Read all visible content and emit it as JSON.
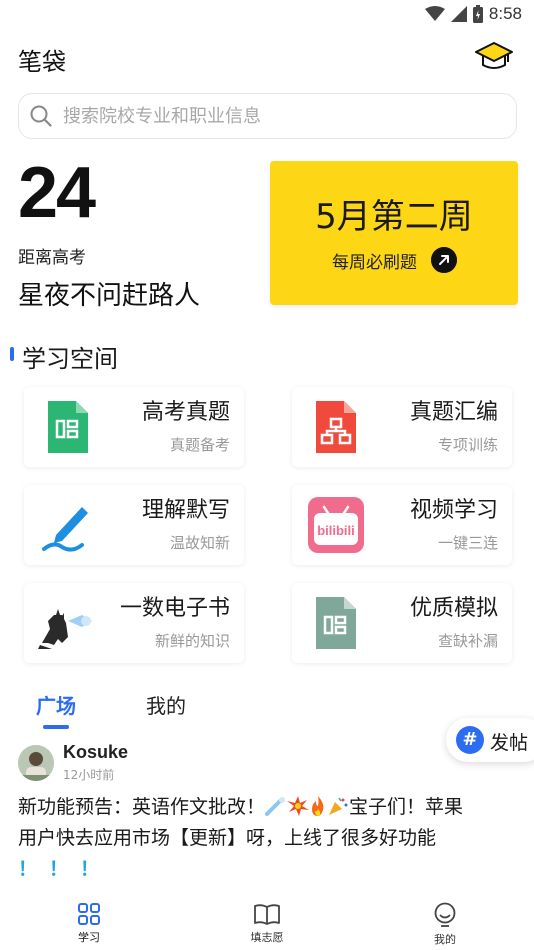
{
  "status_bar": {
    "time": "8:58"
  },
  "header": {
    "title": "笔袋",
    "icon": "graduation-cap-icon"
  },
  "search": {
    "placeholder": "搜索院校专业和职业信息",
    "icon": "search-icon"
  },
  "countdown": {
    "days": "24",
    "label": "距离高考",
    "motto": "星夜不问赶路人"
  },
  "week_card": {
    "title": "5月第二周",
    "subtitle": "每周必刷题",
    "color": "#fdd715"
  },
  "study_space": {
    "title": "学习空间",
    "tiles": [
      {
        "name": "高考真题",
        "sub": "真题备考",
        "icon": "green-document-icon"
      },
      {
        "name": "真题汇编",
        "sub": "专项训练",
        "icon": "red-document-icon"
      },
      {
        "name": "理解默写",
        "sub": "温故知新",
        "icon": "pen-icon"
      },
      {
        "name": "视频学习",
        "sub": "一键三连",
        "icon": "bilibili-icon"
      },
      {
        "name": "一数电子书",
        "sub": "新鲜的知识",
        "icon": "godzilla-icon"
      },
      {
        "name": "优质模拟",
        "sub": "查缺补漏",
        "icon": "gray-document-icon"
      }
    ]
  },
  "feed_tabs": {
    "active": "广场",
    "inactive": "我的"
  },
  "post_button": {
    "label": "发帖"
  },
  "post": {
    "username": "Kosuke",
    "time": "12小时前",
    "text_line1_a": "新功能预告：英语作文批改！",
    "text_line1_b": "宝子们！苹果",
    "text_line2": "用户快去应用市场【更新】呀，上线了很多好功能",
    "text_line3": "！！！"
  },
  "bottom_nav": {
    "items": [
      {
        "label": "学习",
        "icon": "grid-icon",
        "active": true
      },
      {
        "label": "填志愿",
        "icon": "book-icon",
        "active": false
      },
      {
        "label": "我的",
        "icon": "person-icon",
        "active": false
      }
    ],
    "accent": "#2b6cf0"
  }
}
